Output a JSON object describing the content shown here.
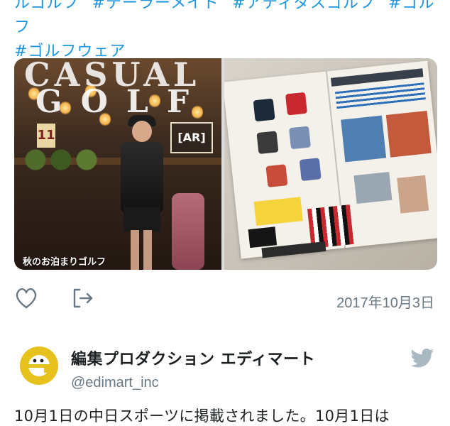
{
  "hashtags": {
    "line1": [
      "ルゴルフ",
      "#テーラーメイド",
      "#アディダスゴルフ",
      "#ゴルフ"
    ],
    "line2": "#ゴルフウェア"
  },
  "media": {
    "cover_title_line1": "CASUAL",
    "cover_title_line2": "GOLF",
    "issue_number": "11",
    "badge": "[AR]",
    "cover_caption": "秋のお泊まりゴルフ"
  },
  "actions": {
    "like_icon": "heart-icon",
    "share_icon": "share-icon",
    "date": "2017年10月3日"
  },
  "author": {
    "name": "編集プロダクション エディマート",
    "handle": "@edimart_inc",
    "avatar_icon": "edimart-logo",
    "brand_icon": "twitter-bird-icon",
    "colors": {
      "avatar_yellow": "#e8c21c",
      "twitter_gray": "#aab8c2",
      "hashtag_blue": "#1b95e0",
      "secondary_text": "#697882"
    }
  },
  "tweet": {
    "text": "10月1日の中日スポーツに掲載されました。10月1日は"
  }
}
